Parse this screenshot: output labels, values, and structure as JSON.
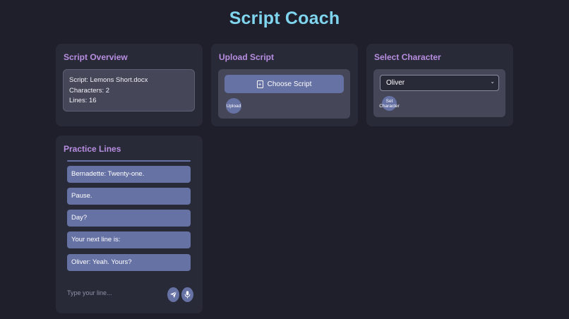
{
  "app": {
    "title": "Script Coach"
  },
  "overview": {
    "title": "Script Overview",
    "script_line": "Script: Lemons Short.docx",
    "characters_line": "Characters: 2",
    "lines_line": "Lines: 16"
  },
  "upload": {
    "title": "Upload Script",
    "choose_label": "Choose Script",
    "upload_label": "Upload"
  },
  "select": {
    "title": "Select Character",
    "selected_value": "Oliver",
    "set_label": "Set Character"
  },
  "practice": {
    "title": "Practice Lines",
    "messages": [
      "Bernadette: Twenty-one.",
      "Pause.",
      "Day?",
      "Your next line is:",
      "Oliver: Yeah. Yours?"
    ],
    "input_placeholder": "Type your line..."
  },
  "colors": {
    "background": "#1e1f2b",
    "card": "#292a38",
    "accent_title": "#7fd4ee",
    "card_title": "#b78ee0",
    "button": "#6671a4"
  },
  "icons": {
    "choose": "file-plus-icon",
    "send": "send-icon",
    "mic": "microphone-icon",
    "select": "chevron-down-icon"
  }
}
